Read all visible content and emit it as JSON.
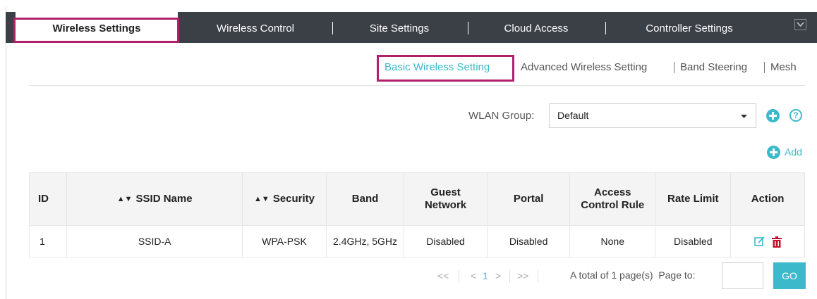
{
  "top_tabs": [
    {
      "label": "Wireless Settings",
      "active": true
    },
    {
      "label": "Wireless Control"
    },
    {
      "label": "Site Settings"
    },
    {
      "label": "Cloud Access"
    },
    {
      "label": "Controller Settings"
    }
  ],
  "sub_tabs": [
    {
      "label": "Basic Wireless Setting",
      "active": true
    },
    {
      "label": "Advanced Wireless Setting"
    },
    {
      "label": "Band Steering"
    },
    {
      "label": "Mesh"
    }
  ],
  "wlan": {
    "label": "WLAN Group:",
    "selected": "Default",
    "help_icon_text": "?"
  },
  "add_label": "Add",
  "table": {
    "columns": [
      "ID",
      "SSID Name",
      "Security",
      "Band",
      "Guest Network",
      "Portal",
      "Access Control Rule",
      "Rate Limit",
      "Action"
    ],
    "rows": [
      {
        "id": "1",
        "ssid": "SSID-A",
        "security": "WPA-PSK",
        "band": "2.4GHz, 5GHz",
        "guest": "Disabled",
        "portal": "Disabled",
        "acl": "None",
        "rate": "Disabled"
      }
    ]
  },
  "pagination": {
    "first": "<<",
    "prev": "<",
    "current": "1",
    "next": ">",
    "last": ">>",
    "total": "A total of 1 page(s)",
    "page_to": "Page to:",
    "go": "GO"
  },
  "colors": {
    "accent": "#3cb9cb",
    "header_bg": "#3b3f46",
    "highlight": "#b1206a"
  }
}
